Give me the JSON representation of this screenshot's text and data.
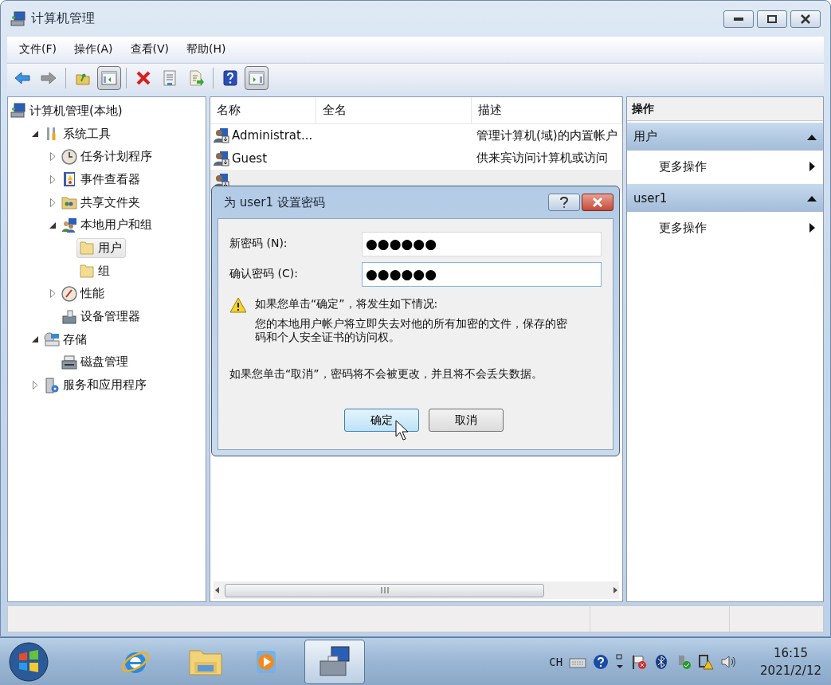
{
  "window": {
    "title": "计算机管理"
  },
  "menu": [
    {
      "label": "文件(F)"
    },
    {
      "label": "操作(A)"
    },
    {
      "label": "查看(V)"
    },
    {
      "label": "帮助(H)"
    }
  ],
  "toolbar": [
    {
      "pressed": false,
      "disabled": false
    },
    {
      "pressed": false,
      "disabled": true
    },
    {
      "pressed": false,
      "disabled": false
    },
    {
      "pressed": true,
      "disabled": false
    },
    {
      "pressed": false,
      "disabled": false
    },
    {
      "pressed": false,
      "disabled": false
    },
    {
      "pressed": false,
      "disabled": false
    },
    {
      "pressed": false,
      "disabled": false
    },
    {
      "pressed": true,
      "disabled": false
    }
  ],
  "tree": {
    "label": "计算机管理(本地)",
    "selected": false,
    "children": [
      {
        "label": "系统工具",
        "selected": false,
        "expanded": true,
        "children": [
          {
            "label": "任务计划程序",
            "selected": false,
            "expanded": false
          },
          {
            "label": "事件查看器",
            "selected": false,
            "expanded": false
          },
          {
            "label": "共享文件夹",
            "selected": false,
            "expanded": false
          },
          {
            "label": "本地用户和组",
            "selected": false,
            "expanded": true,
            "children": [
              {
                "label": "用户",
                "selected": true
              },
              {
                "label": "组",
                "selected": false
              }
            ]
          },
          {
            "label": "性能",
            "selected": false,
            "expanded": false
          },
          {
            "label": "设备管理器",
            "selected": false
          }
        ]
      },
      {
        "label": "存储",
        "selected": false,
        "expanded": true,
        "children": [
          {
            "label": "磁盘管理",
            "selected": false
          }
        ]
      },
      {
        "label": "服务和应用程序",
        "selected": false,
        "expanded": false
      }
    ]
  },
  "list": {
    "columns": [
      "名称",
      "全名",
      "描述"
    ],
    "rows": [
      {
        "name": "Administrat...",
        "description": "管理计算机(域)的内置帐户",
        "selected": false
      },
      {
        "name": "Guest",
        "description": "供来宾访问计算机或访问",
        "selected": false
      },
      {
        "selected": true
      }
    ]
  },
  "actions": {
    "title": "操作",
    "sections": [
      {
        "title": "用户",
        "expanded": true,
        "items": [
          "更多操作"
        ]
      },
      {
        "title": "user1",
        "expanded": true,
        "items": [
          "更多操作"
        ]
      }
    ]
  },
  "dialog": {
    "title": "为 user1 设置密码",
    "fields": [
      {
        "label": "新密码 (N):",
        "value": "●●●●●●",
        "focused": false
      },
      {
        "label": "确认密码 (C):",
        "value": "●●●●●●",
        "focused": true
      }
    ],
    "warning_title": "如果您单击“确定”，将发生如下情况:",
    "warning_text": "您的本地用户帐户将立即失去对他的所有加密的文件，保存的密码和个人安全证书的访问权。",
    "cancel_note": "如果您单击“取消”，密码将不会被更改，并且将不会丢失数据。",
    "buttons": [
      {
        "label": "确定",
        "default": true
      },
      {
        "label": "取消",
        "default": false
      }
    ]
  },
  "taskbar": {
    "apps": [
      {
        "active": false
      },
      {
        "active": false
      },
      {
        "active": false
      },
      {
        "active": true
      }
    ],
    "language": "CH",
    "time": "16:15",
    "date": "2021/2/12"
  }
}
